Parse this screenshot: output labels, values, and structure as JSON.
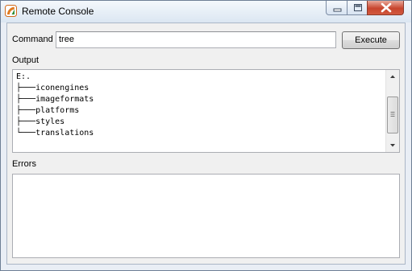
{
  "window": {
    "title": "Remote Console",
    "app_icon": "app-logo-icon",
    "controls": [
      "minimize-icon",
      "maximize-icon",
      "close-icon"
    ]
  },
  "command": {
    "label": "Command",
    "value": "tree"
  },
  "execute_button": {
    "label": "Execute"
  },
  "output": {
    "label": "Output",
    "text": "E:.\n├───iconengines\n├───imageformats\n├───platforms\n├───styles\n└───translations"
  },
  "errors": {
    "label": "Errors",
    "text": ""
  },
  "colors": {
    "close_button": "#c7452e",
    "titlebar": "#dbe6f2",
    "client_background": "#f0f0f0"
  }
}
